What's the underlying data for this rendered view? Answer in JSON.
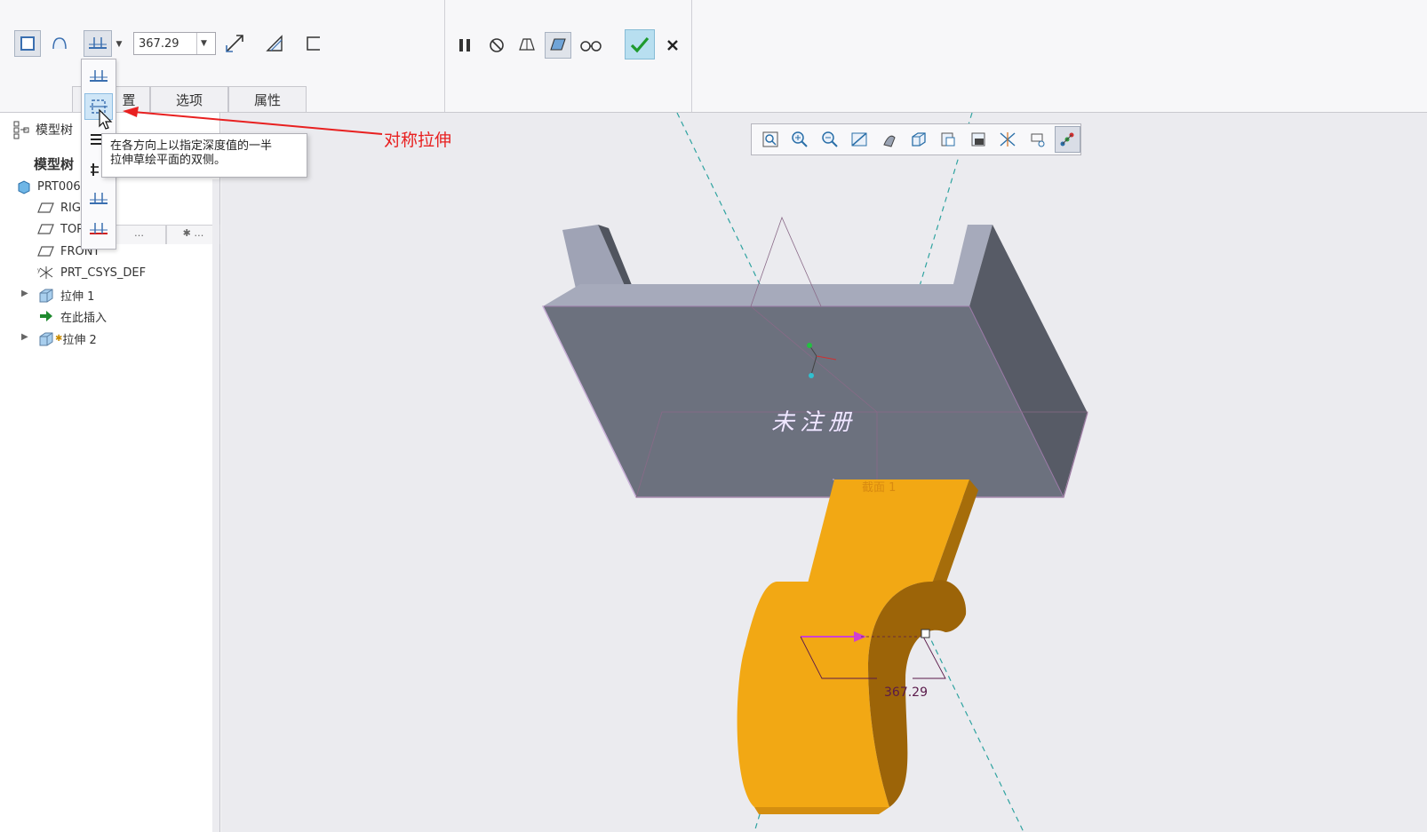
{
  "ribbon": {
    "depth_value": "367.29",
    "tabs": [
      {
        "label": "放置",
        "visible": "置"
      },
      {
        "label": "选项"
      },
      {
        "label": "属性"
      }
    ]
  },
  "depth_menu": {
    "tooltip_line1": "在各方向上以指定深度值的一半",
    "tooltip_line2": "拉伸草绘平面的双侧。"
  },
  "annotation": {
    "label": "对称拉伸",
    "color": "#e82020"
  },
  "model_tree": {
    "header": "模型树",
    "sub_header": "模型树",
    "items": [
      {
        "label": "PRT006",
        "icon": "part-icon"
      },
      {
        "label": "RIG",
        "icon": "datum-plane-icon"
      },
      {
        "label": "TOP",
        "icon": "datum-plane-icon"
      },
      {
        "label": "FRONT",
        "icon": "datum-plane-icon"
      },
      {
        "label": "PRT_CSYS_DEF",
        "icon": "csys-icon"
      },
      {
        "label": "拉伸 1",
        "icon": "extrude-icon"
      },
      {
        "label": "在此插入",
        "icon": "insert-here-icon"
      },
      {
        "label": "拉伸 2",
        "icon": "extrude-icon"
      }
    ]
  },
  "graphics": {
    "watermark": "未注册",
    "section_label": "截面 1",
    "dimension_value": "367.29",
    "colors": {
      "solid_face": "#6c717e",
      "solid_top": "#9fa3b5",
      "preview_fill": "#f2a814"
    }
  }
}
